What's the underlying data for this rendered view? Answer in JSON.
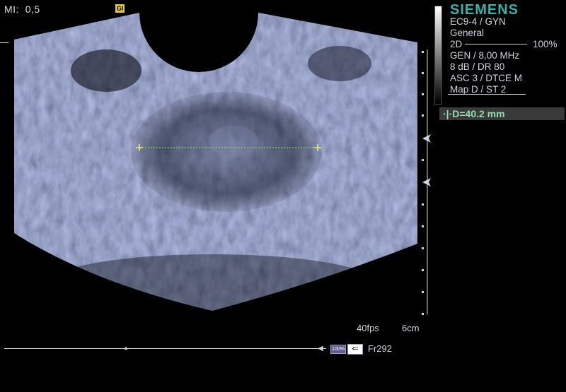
{
  "header": {
    "mi_label": "MI:",
    "mi_value": "0,5",
    "badge": "GI"
  },
  "panel": {
    "brand": "SIEMENS",
    "probe": "EC9-4 / GYN",
    "preset": "General",
    "mode": "2D",
    "gain": "100%",
    "frequency": "GEN / 8,00 MHz",
    "dynamic_range": "8 dB / DR 80",
    "asc": "ASC 3 / DTCE M",
    "map": "Map D / ST 2"
  },
  "measurement": {
    "text": "D=40.2 mm",
    "marker_color": "#8fdfb0",
    "line_color": "#9fe07a"
  },
  "footer": {
    "fps": "40fps",
    "depth": "6cm",
    "zoom_button": "100%",
    "frame": "Fr292"
  },
  "colors": {
    "brand": "#3bb0aa",
    "background": "#000000",
    "text": "#cfd3dc"
  },
  "icons": {
    "back": "arrow-left-icon",
    "focus": "triangle-left-icon"
  }
}
